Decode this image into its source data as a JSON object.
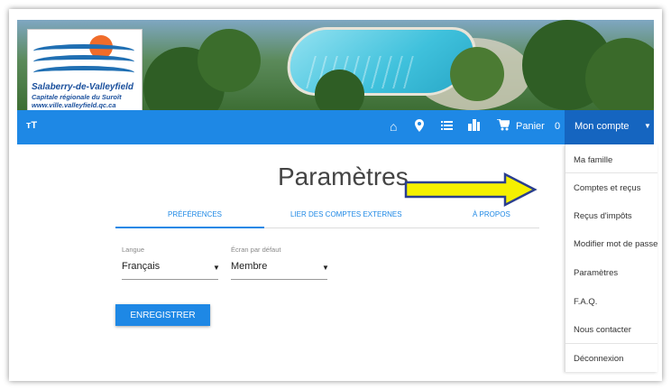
{
  "logo": {
    "name": "Salaberry-de-Valleyfield",
    "tagline": "Capitale régionale du Suroît",
    "url": "www.ville.valleyfield.qc.ca"
  },
  "navbar": {
    "left_icon": "text-size-icon",
    "icons": [
      "home-icon",
      "map-pin-icon",
      "list-icon",
      "building-icon",
      "cart-icon"
    ],
    "cart_label": "Panier",
    "cart_count": "0",
    "account_label": "Mon compte",
    "color": "#1e88e5",
    "account_bg": "#1565c0"
  },
  "page": {
    "title": "Paramètres"
  },
  "tabs": [
    {
      "label": "Préférences",
      "active": true
    },
    {
      "label": "Lier des comptes externes",
      "active": false
    },
    {
      "label": "À propos",
      "active": false
    }
  ],
  "form": {
    "language_label": "Langue",
    "language_value": "Français",
    "default_screen_label": "Écran par défaut",
    "default_screen_value": "Membre",
    "save_label": "ENREGISTRER"
  },
  "account_menu": {
    "items": [
      "Ma famille",
      "Comptes et reçus",
      "Reçus d'impôts",
      "Modifier mot de passe",
      "Paramètres",
      "F.A.Q.",
      "Nous contacter",
      "Déconnexion"
    ]
  },
  "annotation": {
    "arrow_color": "#f5f000",
    "arrow_outline": "#2b3f8f"
  }
}
